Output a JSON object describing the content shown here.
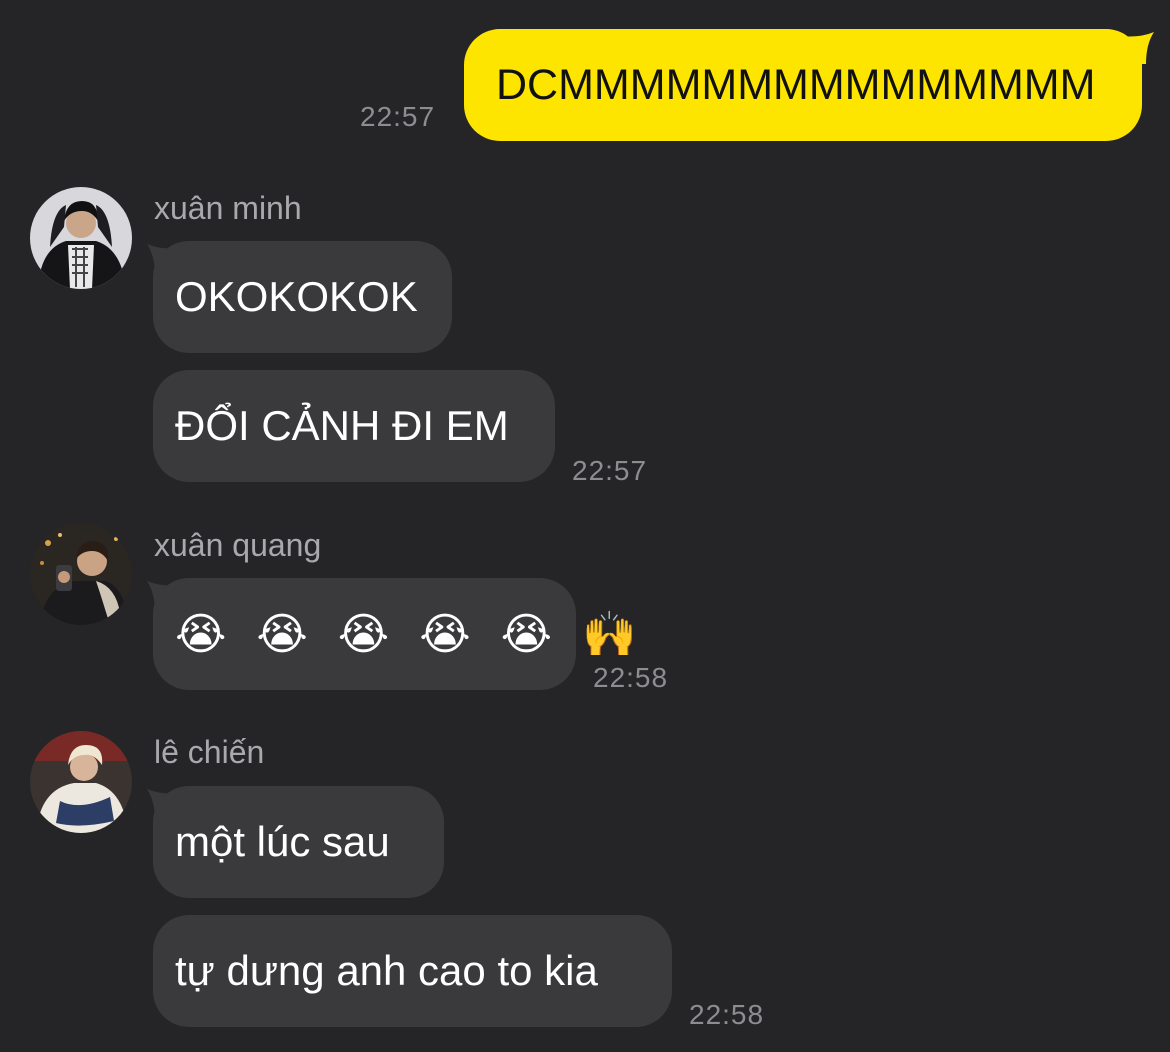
{
  "chat": {
    "colors": {
      "background": "#252527",
      "incoming_bubble": "#3a3a3c",
      "outgoing_bubble": "#fee500",
      "timestamp": "#8d8d91",
      "sender_name": "#a9a9ad"
    },
    "outgoing": {
      "text": "DCMMMMMMMMMMMMMMM",
      "time": "22:57"
    },
    "groups": [
      {
        "sender": "xuân minh",
        "avatar_icon": "profile-photo-icon",
        "messages": [
          "OKOKOKOK",
          "ĐỔI CẢNH ĐI EM"
        ],
        "time": "22:57"
      },
      {
        "sender": "xuân quang",
        "avatar_icon": "profile-photo-icon",
        "messages": [
          "😭 😭 😭 😭 😭 🙌"
        ],
        "time": "22:58"
      },
      {
        "sender": "lê chiến",
        "avatar_icon": "profile-photo-icon",
        "messages": [
          "một lúc sau",
          "tự dưng anh cao to kia"
        ],
        "time": "22:58"
      }
    ]
  }
}
